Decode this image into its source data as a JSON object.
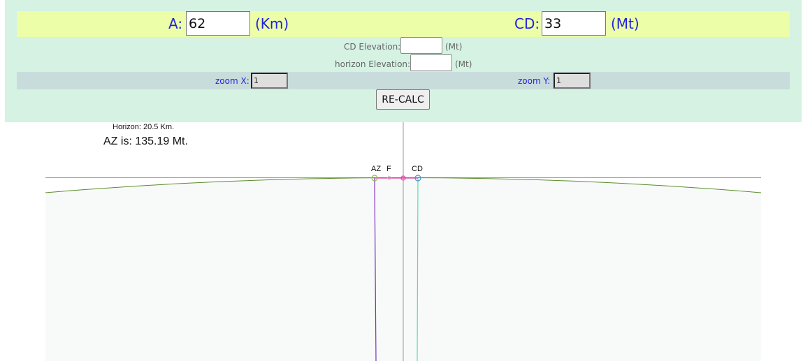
{
  "main": {
    "a_label": "A:",
    "a_value": "62",
    "a_unit": "(Km)",
    "cd_label": "CD:",
    "cd_value": "33",
    "cd_unit": "(Mt)"
  },
  "elevations": {
    "cd_label": "CD Elevation:",
    "cd_value": "",
    "cd_unit": "(Mt)",
    "horizon_label": "horizon Elevation:",
    "horizon_value": "",
    "horizon_unit": "(Mt)"
  },
  "zoom": {
    "x_label": "zoom X:",
    "x_value": "1",
    "y_label": "zoom Y:",
    "y_value": "1"
  },
  "recalc_label": "RE-CALC",
  "results": {
    "horizon_text": "Horizon: 20.5 Km.",
    "az_text": "AZ is: 135.19 Mt."
  },
  "plot": {
    "labels": {
      "az": "AZ",
      "f": "F",
      "cd": "CD"
    },
    "colors": {
      "curve": "#5b8c2a",
      "ground_fill": "#f8faf9",
      "axis": "#999999",
      "az_line": "#7b2fbe",
      "cd_line": "#4fe0b0",
      "midline": "#e040a0",
      "az_marker": "#8bc34a",
      "cd_marker": "#4a90d9"
    }
  }
}
